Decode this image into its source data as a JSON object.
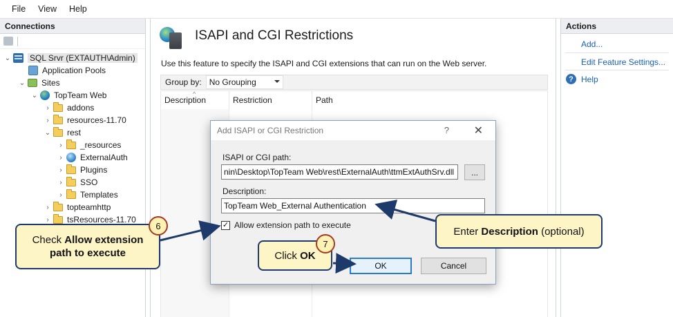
{
  "menu": {
    "items": [
      "File",
      "View",
      "Help"
    ]
  },
  "connections": {
    "title": "Connections",
    "tree": [
      {
        "label": "SQL Srvr (EXTAUTH\\Admin)",
        "depth": 0,
        "icon": "server-icon",
        "expanded": true,
        "selected": true
      },
      {
        "label": "Application Pools",
        "depth": 1,
        "icon": "app-pool-icon"
      },
      {
        "label": "Sites",
        "depth": 1,
        "icon": "sites-icon",
        "expanded": true
      },
      {
        "label": "TopTeam Web",
        "depth": 2,
        "icon": "globe-icon",
        "expanded": true
      },
      {
        "label": "addons",
        "depth": 3,
        "icon": "folder-icon",
        "collapsed": true
      },
      {
        "label": "resources-11.70",
        "depth": 3,
        "icon": "folder-icon",
        "collapsed": true
      },
      {
        "label": "rest",
        "depth": 3,
        "icon": "folder-icon",
        "expanded": true
      },
      {
        "label": "_resources",
        "depth": 4,
        "icon": "folder-icon",
        "collapsed": true
      },
      {
        "label": "ExternalAuth",
        "depth": 4,
        "icon": "web-app-icon",
        "collapsed": true
      },
      {
        "label": "Plugins",
        "depth": 4,
        "icon": "folder-icon",
        "collapsed": true
      },
      {
        "label": "SSO",
        "depth": 4,
        "icon": "folder-icon",
        "collapsed": true
      },
      {
        "label": "Templates",
        "depth": 4,
        "icon": "folder-icon",
        "collapsed": true
      },
      {
        "label": "topteamhttp",
        "depth": 3,
        "icon": "folder-icon",
        "collapsed": true
      },
      {
        "label": "tsResources-11.70",
        "depth": 3,
        "icon": "folder-icon",
        "collapsed": true
      }
    ]
  },
  "main": {
    "title": "ISAPI and CGI Restrictions",
    "description": "Use this feature to specify the ISAPI and CGI extensions that can run on the Web server.",
    "group_by_label": "Group by:",
    "group_by_value": "No Grouping",
    "columns": [
      "Description",
      "Restriction",
      "Path"
    ]
  },
  "actions": {
    "title": "Actions",
    "add": "Add...",
    "edit_feature_settings": "Edit Feature Settings...",
    "help": "Help"
  },
  "dialog": {
    "title": "Add ISAPI or CGI Restriction",
    "help_glyph": "?",
    "close_glyph": "✕",
    "path_label": "ISAPI or CGI path:",
    "path_value": "nin\\Desktop\\TopTeam Web\\rest\\ExternalAuth\\ttmExtAuthSrv.dll",
    "browse_label": "...",
    "description_label": "Description:",
    "description_value": "TopTeam Web_External Authentication",
    "allow_checkbox_label": "Allow extension path to execute",
    "allow_checked": true,
    "ok_label": "OK",
    "cancel_label": "Cancel"
  },
  "callouts": {
    "step6": {
      "number": "6",
      "line1_prefix": "Check ",
      "line1_bold": "Allow extension",
      "line2_bold": "path to execute"
    },
    "step7": {
      "number": "7",
      "prefix": "Click ",
      "bold": "OK"
    },
    "description": {
      "prefix": "Enter ",
      "bold": "Description",
      "suffix": " (optional)"
    }
  },
  "colors": {
    "callout_fill": "#fef5c6",
    "callout_border": "#1d3a6b",
    "step_border": "#a43a24",
    "link": "#1a5fb4",
    "arrow": "#1d3a6b"
  }
}
